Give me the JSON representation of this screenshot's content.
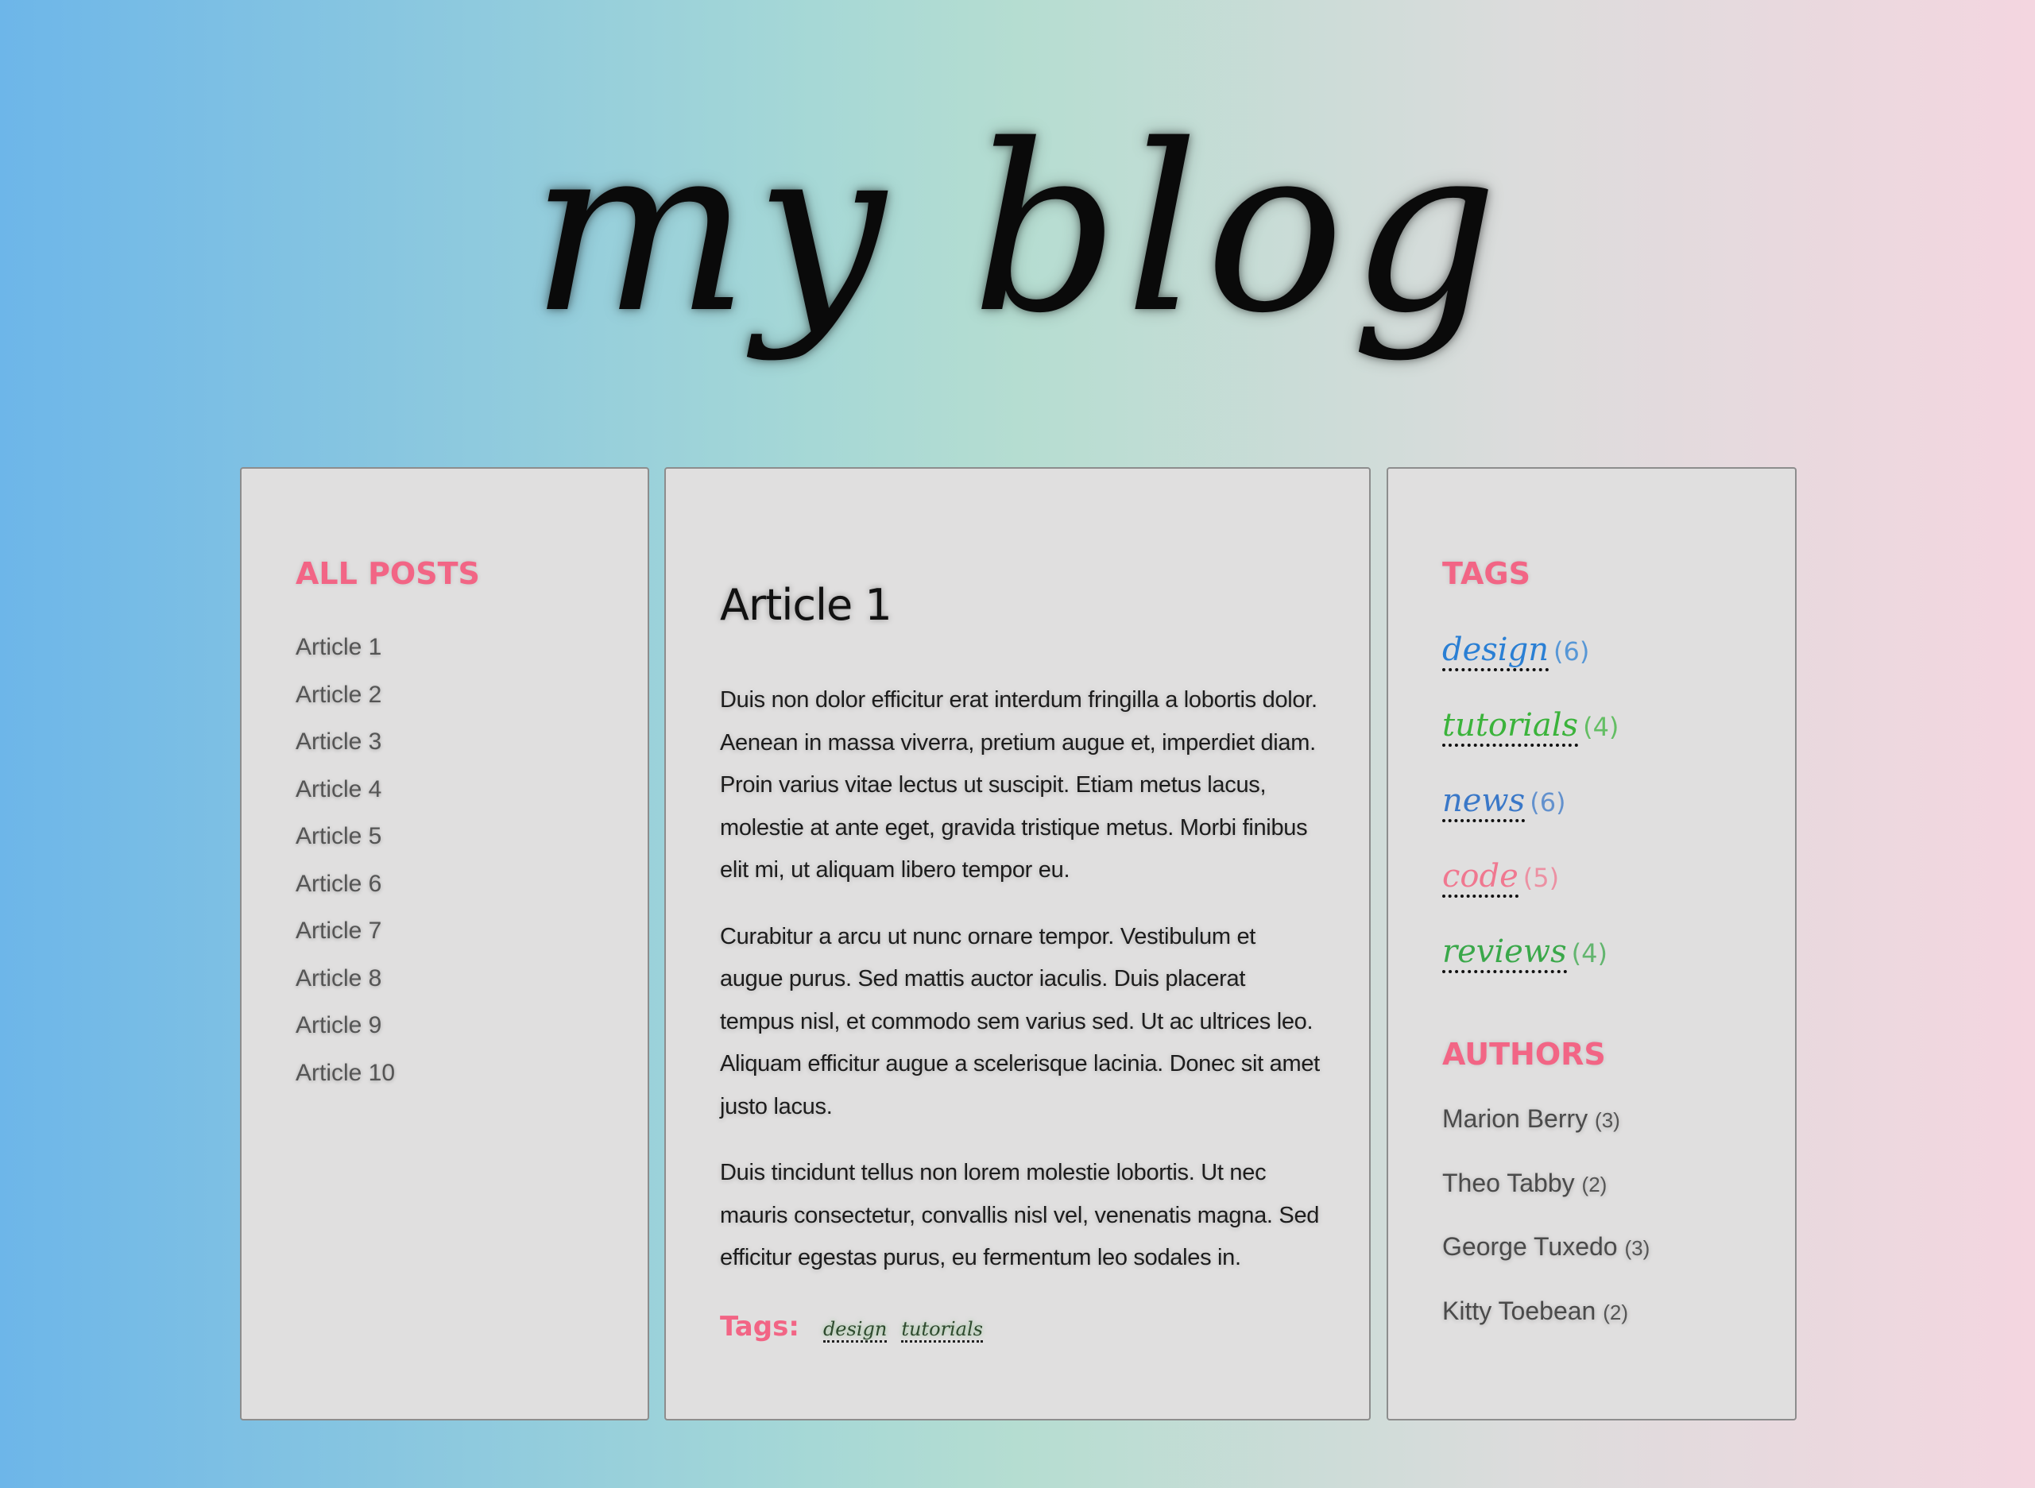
{
  "site": {
    "title": "my blog"
  },
  "all_posts": {
    "heading": "ALL POSTS",
    "items": [
      "Article 1",
      "Article 2",
      "Article 3",
      "Article 4",
      "Article 5",
      "Article 6",
      "Article 7",
      "Article 8",
      "Article 9",
      "Article 10"
    ]
  },
  "article": {
    "title": "Article 1",
    "paragraphs": [
      "Duis non dolor efficitur erat interdum fringilla a lobortis dolor. Aenean in massa viverra, pretium augue et, imperdiet diam. Proin varius vitae lectus ut suscipit. Etiam metus lacus, molestie at ante eget, gravida tristique metus. Morbi finibus elit mi, ut aliquam libero tempor eu.",
      "Curabitur a arcu ut nunc ornare tempor. Vestibulum et augue purus. Sed mattis auctor iaculis. Duis placerat tempus nisl, et commodo sem varius sed. Ut ac ultrices leo. Aliquam efficitur augue a scelerisque lacinia. Donec sit amet justo lacus.",
      "Duis tincidunt tellus non lorem molestie lobortis. Ut nec mauris consectetur, convallis nisl vel, venenatis magna. Sed efficitur egestas purus, eu fermentum leo sodales in."
    ],
    "tags_label": "Tags:",
    "tags": [
      "design",
      "tutorials"
    ]
  },
  "tags": {
    "heading": "TAGS",
    "items": [
      {
        "name": "design",
        "count": "(6)",
        "color": "#2a7fd4"
      },
      {
        "name": "tutorials",
        "count": "(4)",
        "color": "#3bb33b"
      },
      {
        "name": "news",
        "count": "(6)",
        "color": "#3a78c8"
      },
      {
        "name": "code",
        "count": "(5)",
        "color": "#f07890"
      },
      {
        "name": "reviews",
        "count": "(4)",
        "color": "#3aa84a"
      }
    ]
  },
  "authors": {
    "heading": "AUTHORS",
    "items": [
      {
        "name": "Marion Berry",
        "count": "(3)"
      },
      {
        "name": "Theo Tabby",
        "count": "(2)"
      },
      {
        "name": "George Tuxedo",
        "count": "(3)"
      },
      {
        "name": "Kitty Toebean",
        "count": "(2)"
      }
    ]
  }
}
